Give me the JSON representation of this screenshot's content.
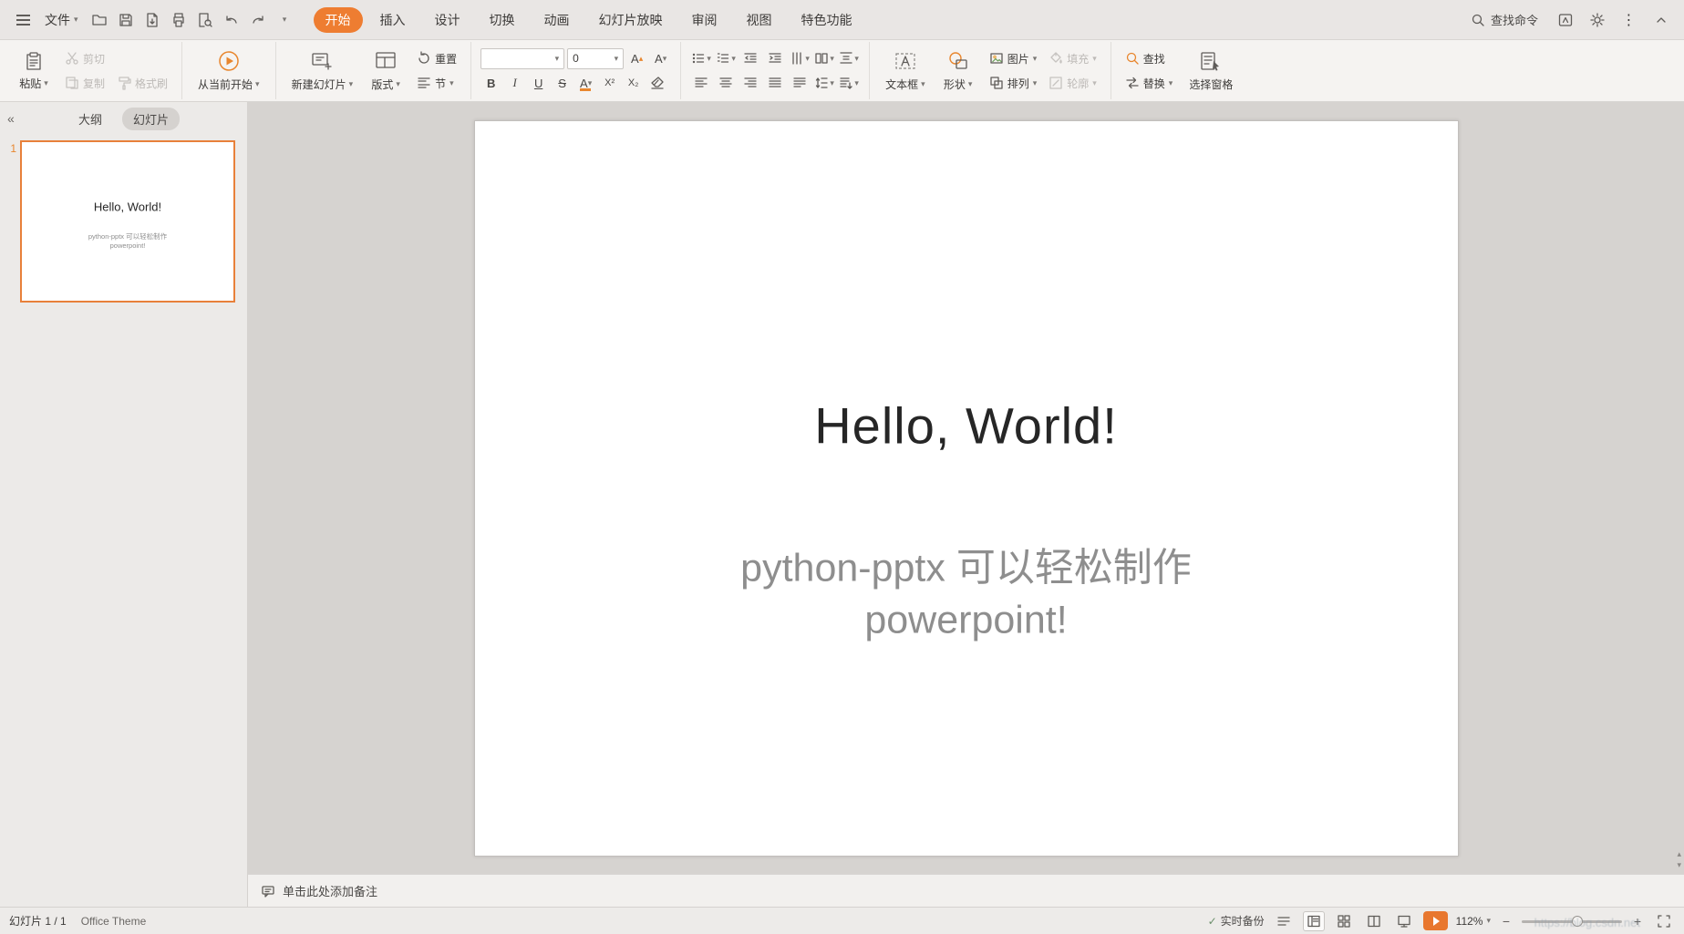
{
  "colors": {
    "accent": "#ee7d31",
    "subtitle_gray": "#8e8e8e",
    "thumb_border": "#e8803a"
  },
  "glyphs": {
    "caret": "▾",
    "up": "▴",
    "down": "▾",
    "collapse": "«",
    "kebab": "⋮",
    "bold": "B",
    "italic": "I",
    "underline": "U",
    "strike": "S",
    "letter_a": "A",
    "sup": "X²",
    "sub": "X₂",
    "check": "✓",
    "minus": "−",
    "plus": "+"
  },
  "menubar": {
    "file": "文件",
    "tabs": [
      "开始",
      "插入",
      "设计",
      "切换",
      "动画",
      "幻灯片放映",
      "审阅",
      "视图",
      "特色功能"
    ],
    "search": "查找命令"
  },
  "ribbon": {
    "paste": "粘贴",
    "cut": "剪切",
    "copy": "复制",
    "format_painter": "格式刷",
    "from_current": "从当前开始",
    "new_slide": "新建幻灯片",
    "layout": "版式",
    "reset": "重置",
    "section": "节",
    "font_name": "",
    "font_size": "0",
    "textbox": "文本框",
    "shapes": "形状",
    "picture": "图片",
    "fill": "填充",
    "arrange": "排列",
    "outline": "轮廓",
    "find": "查找",
    "replace": "替换",
    "selection_pane": "选择窗格"
  },
  "sidebar": {
    "outline_tab": "大纲",
    "slides_tab": "幻灯片",
    "slide_number": "1",
    "thumb_title": "Hello, World!",
    "thumb_sub1": "python-pptx 可以轻松制作",
    "thumb_sub2": "powerpoint!"
  },
  "slide": {
    "title": "Hello, World!",
    "subtitle1": "python-pptx 可以轻松制作",
    "subtitle2": "powerpoint!"
  },
  "notes": {
    "placeholder": "单击此处添加备注"
  },
  "statusbar": {
    "slide_indicator": "幻灯片 1 / 1",
    "theme": "Office Theme",
    "backup": "实时备份",
    "zoom": "112%"
  },
  "watermark": "https://blog.csdn.net"
}
